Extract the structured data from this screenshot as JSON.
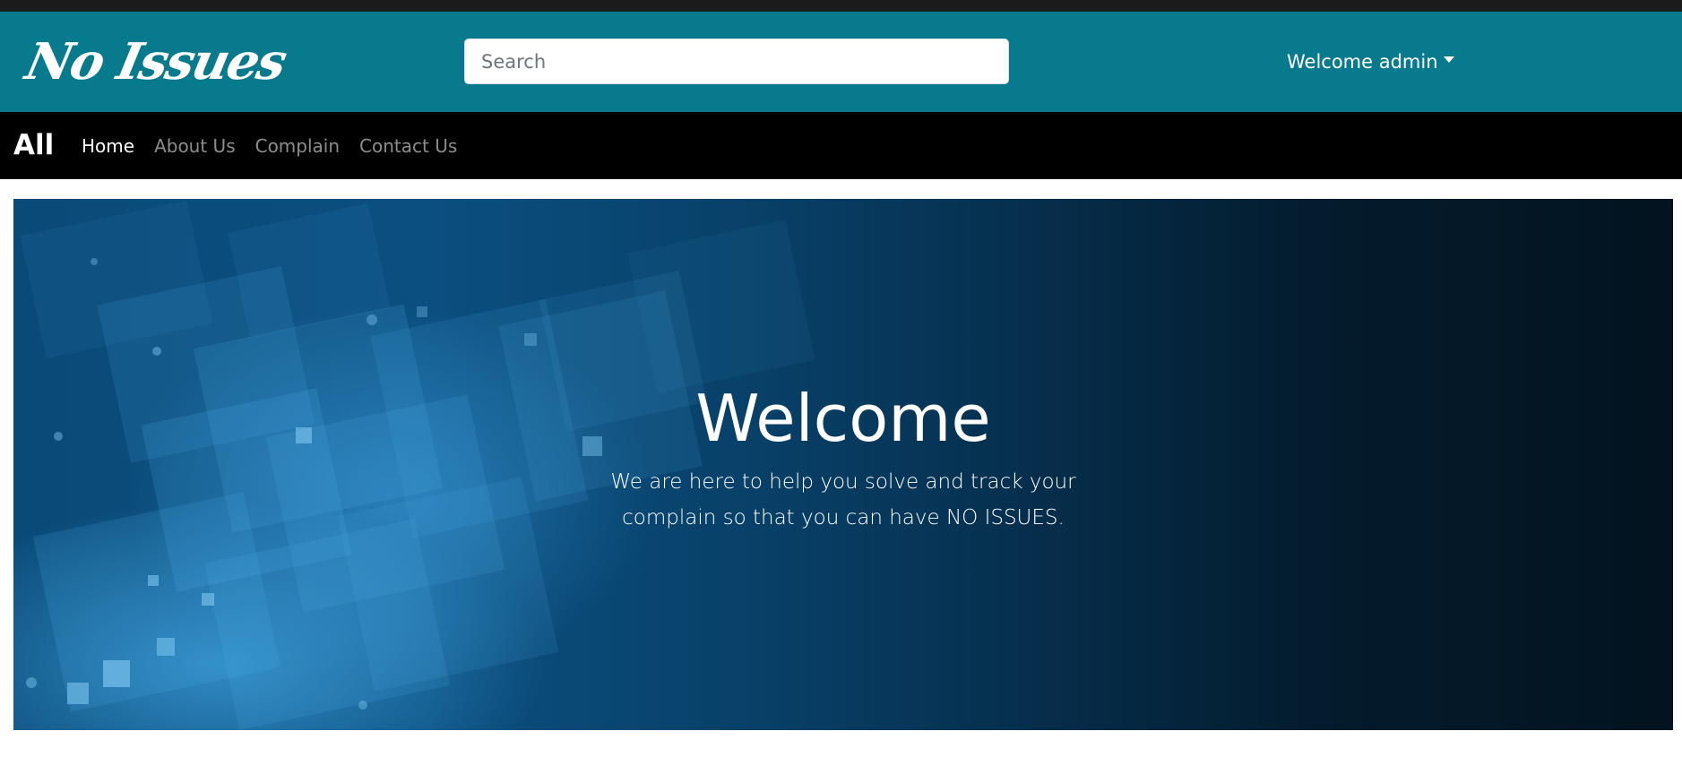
{
  "header": {
    "brand": "No Issues",
    "search_placeholder": "Search",
    "user_menu_label": "Welcome admin"
  },
  "navbar": {
    "brand": "All",
    "links": [
      {
        "label": "Home",
        "active": true
      },
      {
        "label": "About Us",
        "active": false
      },
      {
        "label": "Complain",
        "active": false
      },
      {
        "label": "Contact Us",
        "active": false
      }
    ]
  },
  "hero": {
    "title": "Welcome",
    "text": "We are here to help you solve and track your complain so that you can have NO ISSUES."
  },
  "colors": {
    "header_bg": "#087a8e",
    "navbar_bg": "#000000",
    "hero_dark": "#03131f",
    "hero_blue": "#0b4f80"
  },
  "icons": {
    "user_menu_caret": "caret-down-icon"
  }
}
